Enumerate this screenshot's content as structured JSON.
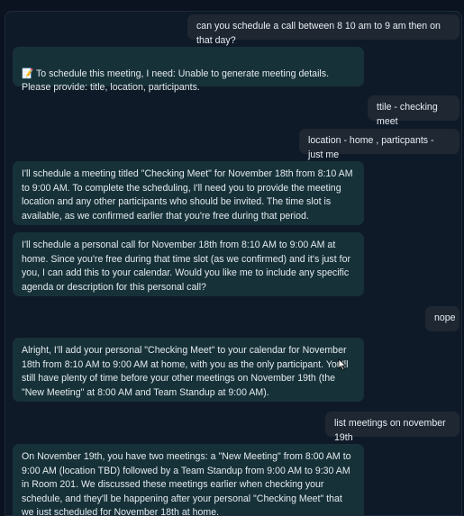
{
  "messages": [
    {
      "role": "user",
      "text": "can you schedule a call between 8 10 am to 9 am then on that day?"
    },
    {
      "role": "assistant",
      "text": "📝 To schedule this meeting, I need: Unable to generate meeting details. Please provide: title, location, participants."
    },
    {
      "role": "user",
      "text": "ttile - checking meet"
    },
    {
      "role": "user",
      "text": "location - home , particpants - just me"
    },
    {
      "role": "assistant",
      "text": "I'll schedule a meeting titled \"Checking Meet\" for November 18th from 8:10 AM to 9:00 AM. To complete the scheduling, I'll need you to provide the meeting location and any other participants who should be invited. The time slot is available, as we confirmed earlier that you're free during that period."
    },
    {
      "role": "assistant",
      "text": "I'll schedule a personal call for November 18th from 8:10 AM to 9:00 AM at home. Since you're free during that time slot (as we confirmed) and it's just for you, I can add this to your calendar. Would you like me to include any specific agenda or description for this personal call?"
    },
    {
      "role": "user",
      "text": "nope"
    },
    {
      "role": "assistant",
      "text": "Alright, I'll add your personal \"Checking Meet\" to your calendar for November 18th from 8:10 AM to 9:00 AM at home, with you as the only participant. You'll still have plenty of time before your other meetings on November 19th (the \"New Meeting\" at 8:00 AM and Team Standup at 9:00 AM)."
    },
    {
      "role": "user",
      "text": "list meetings on november 19th"
    },
    {
      "role": "assistant",
      "text": "On November 19th, you have two meetings: a \"New Meeting\" from 8:00 AM to 9:00 AM (location TBD) followed by a Team Standup from 9:00 AM to 9:30 AM in Room 201. We discussed these meetings earlier when checking your schedule, and they'll be happening after your personal \"Checking Meet\" that we just scheduled for November 18th at home."
    }
  ]
}
